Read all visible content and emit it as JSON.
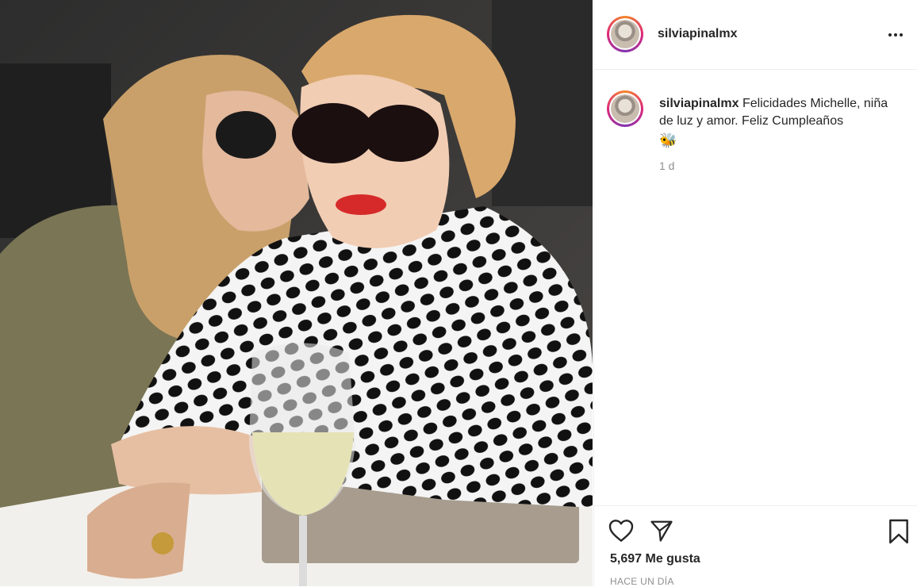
{
  "post": {
    "username": "silviapinalmx",
    "caption_text": "Felicidades Michelle, niña de luz y amor. Feliz Cumpleaños",
    "caption_emoji": "🐝",
    "time_ago": "1 d",
    "likes": "5,697 Me gusta",
    "timestamp": "HACE UN DÍA"
  },
  "icons": {
    "more": "more-options-icon",
    "like": "heart-icon",
    "share": "paper-plane-icon",
    "save": "bookmark-icon"
  },
  "colors": {
    "text": "#262626",
    "muted": "#8e8e8e",
    "border": "#efefef",
    "ring": [
      "#f58529",
      "#dd2a7b",
      "#8134af"
    ]
  }
}
